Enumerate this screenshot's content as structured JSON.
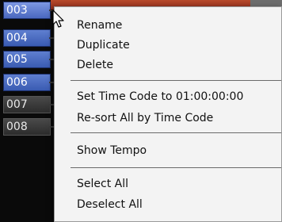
{
  "tracks": [
    {
      "label": "003",
      "style": "selected"
    },
    {
      "label": "004",
      "style": "blue"
    },
    {
      "label": "005",
      "style": "blue"
    },
    {
      "label": "006",
      "style": "blue"
    },
    {
      "label": "007",
      "style": "dark"
    },
    {
      "label": "008",
      "style": "dark"
    }
  ],
  "menu": {
    "rename": "Rename",
    "duplicate": "Duplicate",
    "delete": "Delete",
    "set_time_code": "Set Time Code to 01:00:00:00",
    "resort_by_time_code": "Re-sort All by Time Code",
    "show_tempo": "Show Tempo",
    "select_all": "Select All",
    "deselect_all": "Deselect All"
  },
  "colors": {
    "track_blue": "#4a68c0",
    "track_dark": "#3a3a3a",
    "menu_background": "#f3f3f3",
    "header_accent": "#a83c22"
  },
  "icons": [
    "mouse-pointer-icon"
  ]
}
